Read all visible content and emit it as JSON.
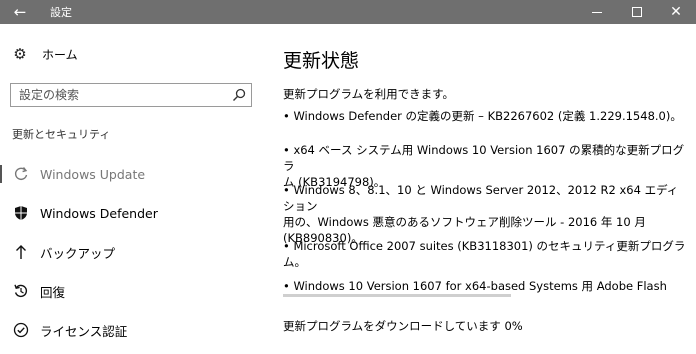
{
  "window": {
    "title": "設定",
    "back_icon": "arrow-left-icon"
  },
  "sidebar": {
    "home_label": "ホーム",
    "search_placeholder": "設定の検索",
    "section_title": "更新とセキュリティ",
    "items": [
      {
        "label": "Windows Update",
        "icon": "sync-icon",
        "active": true
      },
      {
        "label": "Windows Defender",
        "icon": "shield-icon",
        "active": false
      },
      {
        "label": "バックアップ",
        "icon": "backup-arrow-icon",
        "active": false
      },
      {
        "label": "回復",
        "icon": "recovery-icon",
        "active": false
      },
      {
        "label": "ライセンス認証",
        "icon": "activation-check-icon",
        "active": false
      }
    ]
  },
  "main": {
    "title": "更新状態",
    "status": "更新プログラムを利用できます。",
    "updates": [
      {
        "lines": [
          "• Windows Defender の定義の更新 – KB2267602 (定義 1.229.1548.0)。"
        ]
      },
      {
        "lines": [
          "• x64 ベース システム用 Windows 10 Version 1607 の累積的な更新プログラ",
          "ム (KB3194798)。"
        ]
      },
      {
        "lines": [
          "• Windows 8、8.1、10 と Windows Server 2012、2012 R2 x64 エディション",
          "用の、Windows 悪意のあるソフトウェア削除ツール - 2016 年 10 月",
          "(KB890830)。"
        ]
      },
      {
        "lines": [
          "• Microsoft Office 2007 suites (KB3118301) のセキュリティ更新プログラ",
          "ム。"
        ]
      },
      {
        "lines": [
          "• Windows 10 Version 1607 for x64-based Systems 用 Adobe Flash"
        ]
      }
    ],
    "download_progress": 0,
    "download_status": "更新プログラムをダウンロードしています 0%"
  }
}
